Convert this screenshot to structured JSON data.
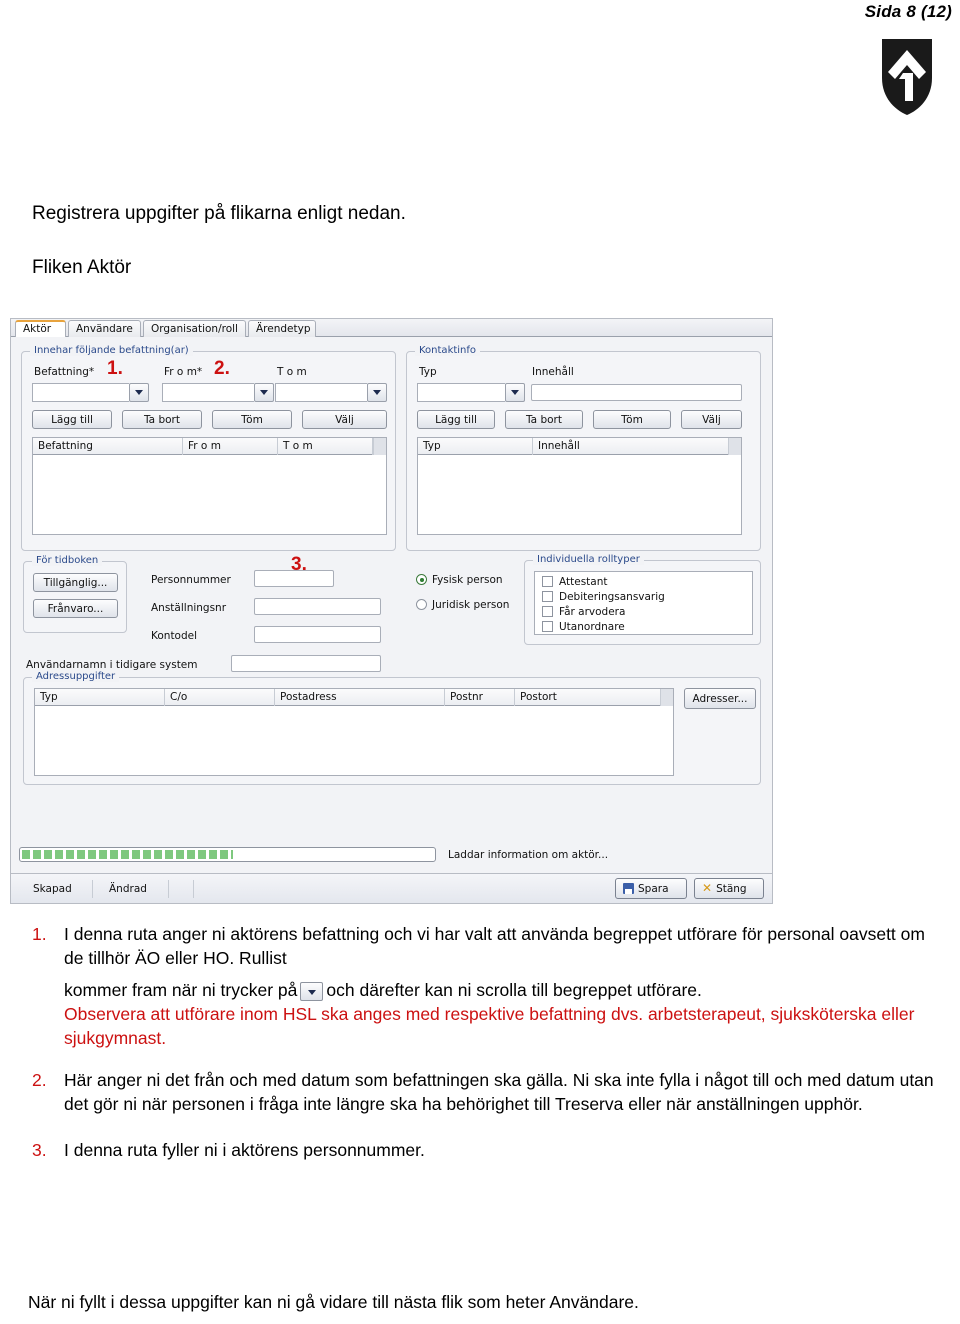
{
  "page_header": {
    "page_label": "Sida 8 (12)",
    "logo_name": "municipality-coat-of-arms"
  },
  "intro": {
    "line1": "Registrera uppgifter på flikarna enligt nedan.",
    "line2": "Fliken Aktör"
  },
  "app": {
    "tabs": [
      {
        "label": "Aktör",
        "active": true
      },
      {
        "label": "Användare",
        "active": false
      },
      {
        "label": "Organisation/roll",
        "active": false
      },
      {
        "label": "Ärendetyp",
        "active": false
      }
    ],
    "befattning_group": {
      "title": "Innehar följande befattning(ar)",
      "labels": {
        "befattning": "Befattning*",
        "from": "Fr o m*",
        "tom": "T o m"
      },
      "markers": {
        "one": "1.",
        "two": "2."
      },
      "buttons": [
        "Lägg till",
        "Ta bort",
        "Töm",
        "Välj"
      ],
      "grid_columns": [
        "Befattning",
        "Fr o m",
        "T o m"
      ]
    },
    "kontaktinfo_group": {
      "title": "Kontaktinfo",
      "labels": {
        "typ": "Typ",
        "innehall": "Innehåll"
      },
      "buttons": [
        "Lägg till",
        "Ta bort",
        "Töm",
        "Välj"
      ],
      "grid_columns": [
        "Typ",
        "Innehåll"
      ]
    },
    "tidbok_group": {
      "title": "För tidboken",
      "buttons": [
        "Tillgänglig...",
        "Frånvaro..."
      ]
    },
    "person_fields": {
      "marker_three": "3.",
      "personnummer_label": "Personnummer",
      "personnummer_value": "",
      "anstallningsnr_label": "Anställningsnr",
      "anstallningsnr_value": "",
      "kontodel_label": "Kontodel",
      "kontodel_value": "",
      "tidigare_system_label": "Användarnamn i tidigare system",
      "tidigare_system_value": ""
    },
    "person_type": {
      "options": [
        {
          "label": "Fysisk person",
          "selected": true
        },
        {
          "label": "Juridisk person",
          "selected": false
        }
      ]
    },
    "rolltyper_group": {
      "title": "Individuella rolltyper",
      "items": [
        {
          "label": "Attestant",
          "checked": false
        },
        {
          "label": "Debiteringsansvarig",
          "checked": false
        },
        {
          "label": "Får arvodera",
          "checked": false
        },
        {
          "label": "Utanordnare",
          "checked": false
        }
      ]
    },
    "adress_group": {
      "title": "Adressuppgifter",
      "grid_columns": [
        "Typ",
        "C/o",
        "Postadress",
        "Postnr",
        "Postort"
      ],
      "button": "Adresser..."
    },
    "status": {
      "progress_text": "Laddar information om aktör...",
      "progress_percent": 52,
      "progress_color": "#7ec87e"
    },
    "footer": {
      "cells": [
        "Skapad",
        "Ändrad"
      ],
      "save_button": "Spara",
      "close_button": "Stäng"
    }
  },
  "notes": [
    {
      "number": "1.",
      "part1": "I denna ruta anger ni aktörens befattning och vi har valt att använda begreppet utförare för personal oavsett om de tillhör ÄO eller HO. Rullist",
      "part2_before": "kommer fram när ni trycker på",
      "part2_after": "och därefter kan ni scrolla till begreppet utförare.",
      "part3_red": "Observera att utförare inom HSL ska anges med respektive befattning dvs. arbetsterapeut, sjuksköterska eller sjukgymnast."
    },
    {
      "number": "2.",
      "text": "Här anger ni det från och med datum som befattningen ska gälla. Ni ska inte fylla i något till och med datum utan det gör ni när personen i fråga inte längre ska ha behörighet till Treserva eller när anställningen upphör."
    },
    {
      "number": "3.",
      "text": "I denna ruta fyller ni i aktörens personnummer."
    }
  ],
  "closing": "När ni fyllt i dessa uppgifter kan ni gå vidare till nästa flik som heter Användare."
}
